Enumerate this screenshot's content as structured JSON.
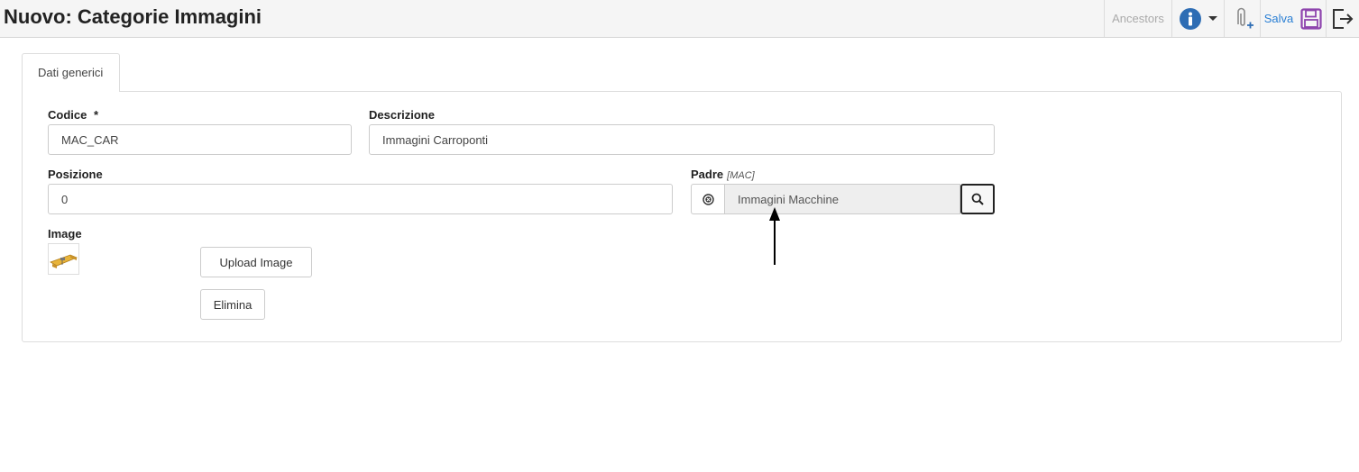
{
  "header": {
    "title": "Nuovo: Categorie Immagini",
    "toolbar": {
      "ancestors_label": "Ancestors",
      "info_icon": "info-icon",
      "attach_icon": "paperclip-plus-icon",
      "save_label": "Salva",
      "save_icon": "floppy-disk-icon",
      "exit_icon": "logout-icon"
    }
  },
  "tabs": [
    {
      "label": "Dati generici",
      "active": true
    }
  ],
  "form": {
    "codice": {
      "label": "Codice",
      "required_mark": "*",
      "value": "MAC_CAR"
    },
    "descrizione": {
      "label": "Descrizione",
      "value": "Immagini Carroponti"
    },
    "posizione": {
      "label": "Posizione",
      "value": "0"
    },
    "padre": {
      "label": "Padre",
      "hint": "[MAC]",
      "value": "Immagini Macchine"
    },
    "image": {
      "label": "Image"
    },
    "upload_button": "Upload Image",
    "delete_button": "Elimina"
  },
  "colors": {
    "accent": "#2a7fd4",
    "info_icon": "#2e6db4",
    "save_icon": "#8e44ad"
  }
}
